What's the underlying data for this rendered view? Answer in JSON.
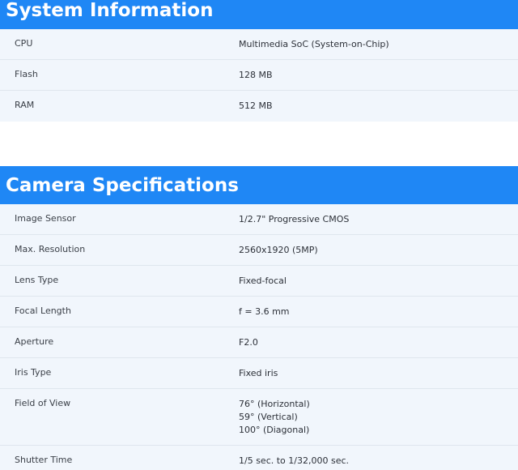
{
  "system": {
    "title": "System Information",
    "rows": [
      {
        "label": "CPU",
        "value": "Multimedia SoC (System-on-Chip)"
      },
      {
        "label": "Flash",
        "value": "128 MB"
      },
      {
        "label": "RAM",
        "value": "512 MB"
      }
    ]
  },
  "camera": {
    "title": "Camera Specifications",
    "rows": [
      {
        "label": "Image Sensor",
        "value": "1/2.7\" Progressive CMOS"
      },
      {
        "label": "Max. Resolution",
        "value": "2560x1920 (5MP)"
      },
      {
        "label": "Lens Type",
        "value": "Fixed-focal"
      },
      {
        "label": "Focal Length",
        "value": "f = 3.6 mm"
      },
      {
        "label": "Aperture",
        "value": "F2.0"
      },
      {
        "label": "Iris Type",
        "value": "Fixed iris"
      },
      {
        "label": "Field of View",
        "value_lines": [
          "76° (Horizontal)",
          "59° (Vertical)",
          "100° (Diagonal)"
        ]
      },
      {
        "label": "Shutter Time",
        "value": "1/5 sec. to 1/32,000 sec."
      }
    ]
  },
  "colors": {
    "header_bg": "#1f87f5",
    "row_bg": "#f1f6fc",
    "divider": "#dfe6ee"
  }
}
